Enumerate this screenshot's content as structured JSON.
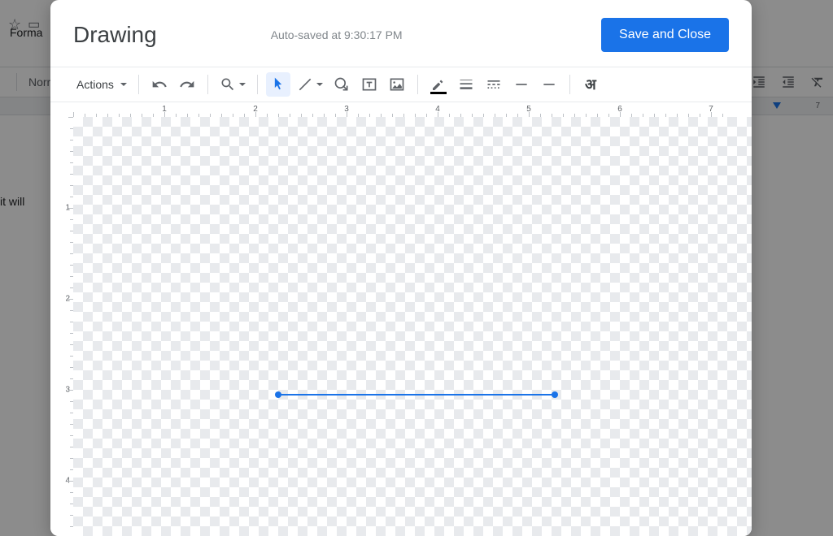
{
  "background": {
    "menu_format": "Forma",
    "toolbar_style": "Norr",
    "body_fragment": "it will",
    "ruler_numbers": [
      "7"
    ]
  },
  "modal": {
    "title": "Drawing",
    "autosave": "Auto-saved at 9:30:17 PM",
    "save_button": "Save and Close",
    "toolbar": {
      "actions": "Actions",
      "hindi": "अ"
    },
    "h_ruler_numbers": [
      "1",
      "2",
      "3",
      "4",
      "5",
      "6",
      "7"
    ],
    "v_ruler_numbers": [
      "1",
      "2",
      "3",
      "4"
    ],
    "drawing": {
      "type": "line",
      "color": "#1a73e8",
      "start_x_inches": 2.25,
      "end_x_inches": 5.3,
      "y_inches": 3.05
    }
  }
}
